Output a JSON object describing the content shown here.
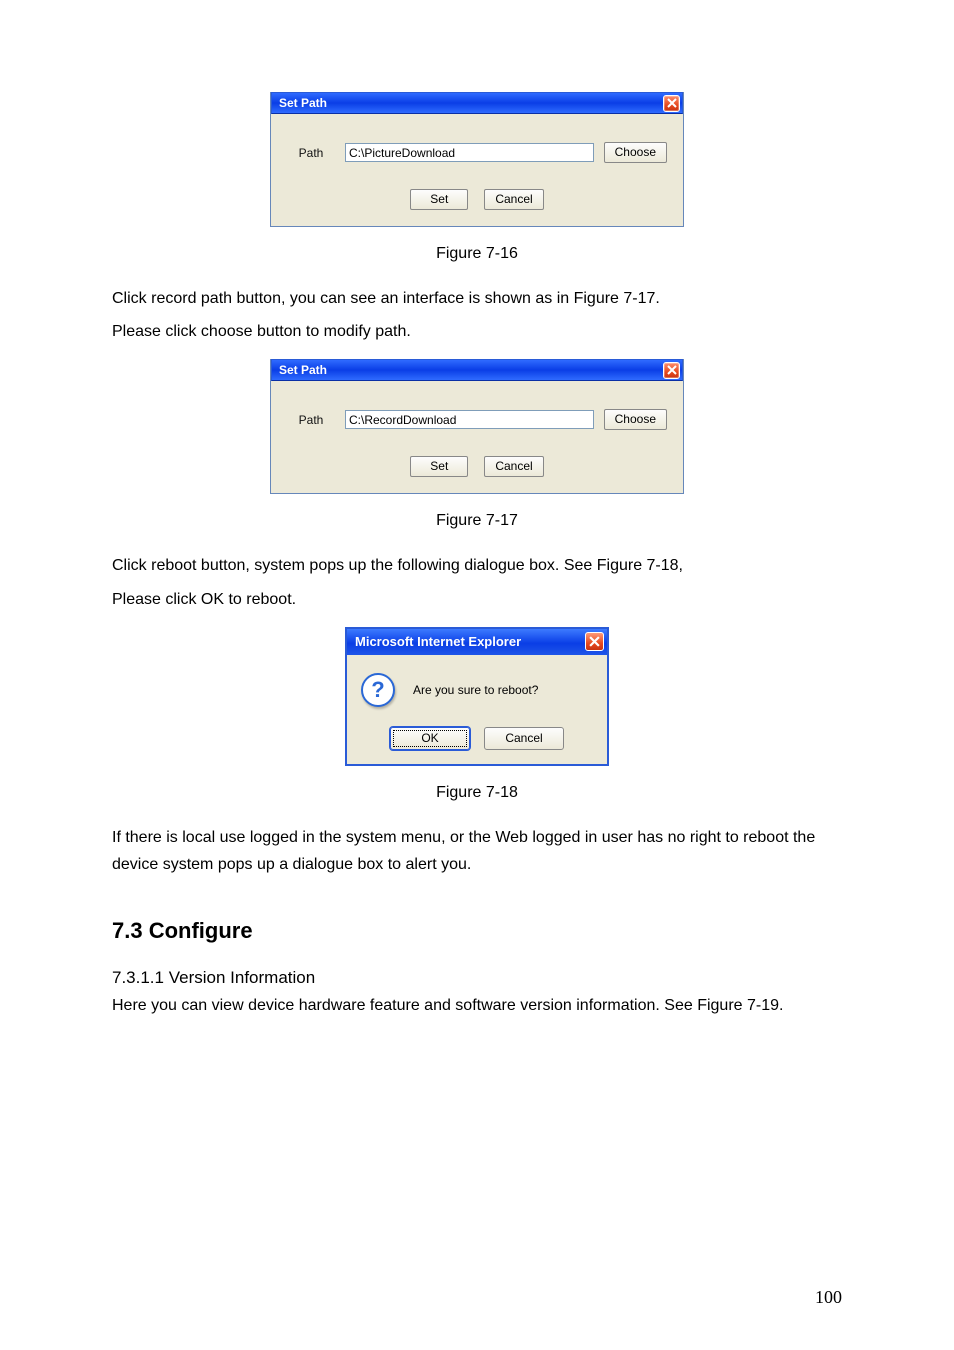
{
  "dialog1": {
    "title": "Set Path",
    "path_label": "Path",
    "path_value": "C:\\PictureDownload",
    "choose": "Choose",
    "set": "Set",
    "cancel": "Cancel"
  },
  "caption1": "Figure 7-16",
  "para1a": "Click record path button, you can see an interface is shown as in Figure 7-17.",
  "para1b": "Please click choose button to modify path.",
  "dialog2": {
    "title": "Set Path",
    "path_label": "Path",
    "path_value": "C:\\RecordDownload",
    "choose": "Choose",
    "set": "Set",
    "cancel": "Cancel"
  },
  "caption2": "Figure 7-17",
  "para2a": "Click reboot button, system pops up the following dialogue box. See Figure 7-18,",
  "para2b": "Please click OK to reboot.",
  "iedlg": {
    "title": "Microsoft Internet Explorer",
    "message": "Are you sure to reboot?",
    "ok": "OK",
    "cancel": "Cancel"
  },
  "caption3": "Figure 7-18",
  "para3": "If there is local use logged in the system menu, or the Web logged in user has no right to reboot the device system pops up a dialogue box to alert you.",
  "heading": "7.3  Configure",
  "subheading": "7.3.1.1  Version Information",
  "para4": "Here you can view device hardware feature and software version information. See Figure 7-19.",
  "pagenum": "100",
  "glyph_q": "?"
}
